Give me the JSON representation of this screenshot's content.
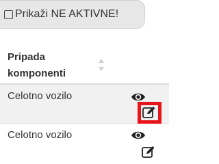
{
  "filter": {
    "show_inactive_label": "Prikaži NE AKTIVNE!"
  },
  "table": {
    "header": {
      "column_label": "Pripada komponenti"
    },
    "rows": [
      {
        "component": "Celotno vozilo"
      },
      {
        "component": "Celotno vozilo"
      }
    ]
  },
  "colors": {
    "highlight": "#e8141c",
    "row_alt": "#f1f1f1"
  },
  "icons": [
    "checkbox-icon",
    "sort-icon",
    "eye-icon",
    "edit-icon"
  ]
}
